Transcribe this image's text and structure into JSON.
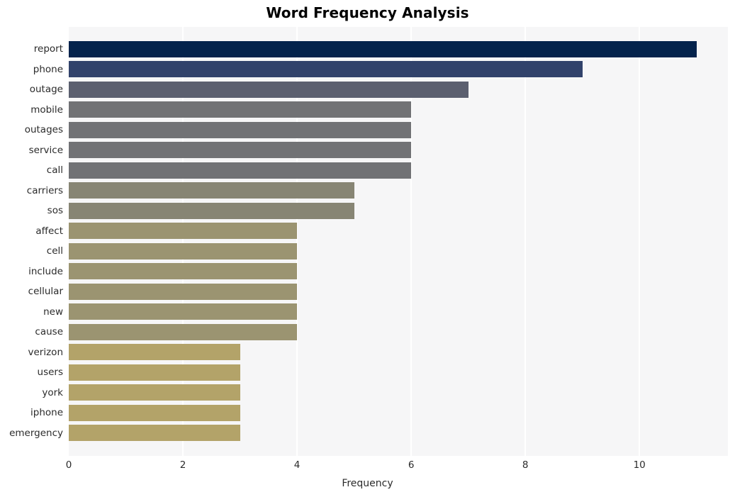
{
  "chart_data": {
    "type": "bar",
    "orientation": "horizontal",
    "title": "Word Frequency Analysis",
    "xlabel": "Frequency",
    "ylabel": "",
    "categories": [
      "report",
      "phone",
      "outage",
      "mobile",
      "outages",
      "service",
      "call",
      "carriers",
      "sos",
      "affect",
      "cell",
      "include",
      "cellular",
      "new",
      "cause",
      "verizon",
      "users",
      "york",
      "iphone",
      "emergency"
    ],
    "values": [
      11,
      9,
      7,
      6,
      6,
      6,
      6,
      5,
      5,
      4,
      4,
      4,
      4,
      4,
      4,
      3,
      3,
      3,
      3,
      3
    ],
    "bar_colors": [
      "#04234c",
      "#31426b",
      "#5b5f6f",
      "#717275",
      "#717275",
      "#717275",
      "#717275",
      "#878574",
      "#878574",
      "#9b9471",
      "#9b9471",
      "#9b9471",
      "#9b9471",
      "#9b9471",
      "#9b9471",
      "#b3a369",
      "#b3a369",
      "#b3a369",
      "#b3a369",
      "#b3a369"
    ],
    "xlim": [
      0,
      11.55
    ],
    "xticks": [
      0,
      2,
      4,
      6,
      8,
      10
    ],
    "xtick_labels": [
      "0",
      "2",
      "4",
      "6",
      "8",
      "10"
    ],
    "gridlines": [
      2,
      4,
      6,
      8,
      10
    ],
    "grid": true,
    "grid_color": "#ffffff",
    "plot_background": "#f6f6f7",
    "figure_background": "#ffffff",
    "legend": null
  }
}
